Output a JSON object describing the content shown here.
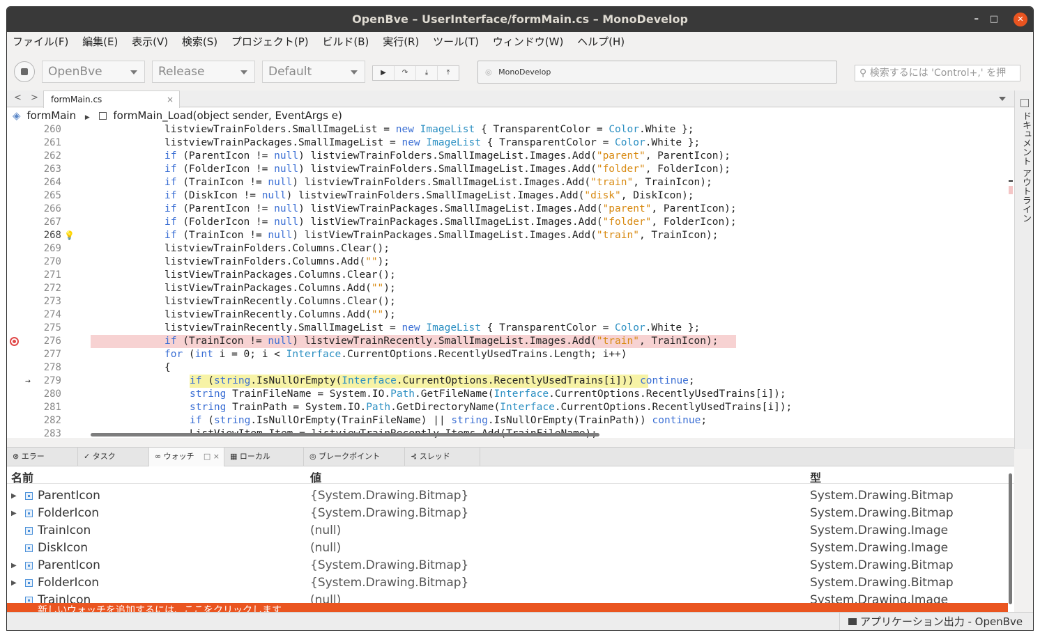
{
  "window": {
    "title": "OpenBve – UserInterface/formMain.cs – MonoDevelop",
    "controls": [
      "–",
      "□",
      "✕"
    ]
  },
  "menu": [
    "ファイル(F)",
    "編集(E)",
    "表示(V)",
    "検索(S)",
    "プロジェクト(P)",
    "ビルド(B)",
    "実行(R)",
    "ツール(T)",
    "ウィンドウ(W)",
    "ヘルプ(H)"
  ],
  "toolbar": {
    "project_combo": "OpenBve",
    "config_combo": "Release",
    "target_combo": "Default",
    "run_icons": [
      "play-icon",
      "step-over-icon",
      "step-into-icon",
      "step-out-icon"
    ],
    "status_text": "MonoDevelop",
    "search_placeholder": "検索するには 'Control+,' を押"
  },
  "tabs": {
    "active": "formMain.cs",
    "close": "×"
  },
  "sidebar": {
    "label": "ドキュメント アウトライン"
  },
  "breadcrumb": {
    "class_name": "formMain",
    "method_name": "formMain_Load(object sender, EventArgs e)"
  },
  "editor": {
    "lines": [
      {
        "num": "260",
        "indent": 1,
        "code": "listviewTrainFolders.SmallImageList = new ImageList { TransparentColor = Color.White };"
      },
      {
        "num": "261",
        "indent": 1,
        "code": "listviewTrainPackages.SmallImageList = new ImageList { TransparentColor = Color.White };"
      },
      {
        "num": "262",
        "indent": 1,
        "code": "if (ParentIcon != null) listviewTrainFolders.SmallImageList.Images.Add(\"parent\", ParentIcon);"
      },
      {
        "num": "263",
        "indent": 1,
        "code": "if (FolderIcon != null) listviewTrainFolders.SmallImageList.Images.Add(\"folder\", FolderIcon);"
      },
      {
        "num": "264",
        "indent": 1,
        "code": "if (TrainIcon != null) listviewTrainFolders.SmallImageList.Images.Add(\"train\", TrainIcon);"
      },
      {
        "num": "265",
        "indent": 1,
        "code": "if (DiskIcon != null) listviewTrainFolders.SmallImageList.Images.Add(\"disk\", DiskIcon);"
      },
      {
        "num": "266",
        "indent": 1,
        "code": "if (ParentIcon != null) listViewTrainPackages.SmallImageList.Images.Add(\"parent\", ParentIcon);"
      },
      {
        "num": "267",
        "indent": 1,
        "code": "if (FolderIcon != null) listViewTrainPackages.SmallImageList.Images.Add(\"folder\", FolderIcon);"
      },
      {
        "num": "268",
        "indent": 1,
        "code": "if (TrainIcon != null) listViewTrainPackages.SmallImageList.Images.Add(\"train\", TrainIcon);",
        "bulb": true
      },
      {
        "num": "269",
        "indent": 1,
        "code": "listviewTrainFolders.Columns.Clear();"
      },
      {
        "num": "270",
        "indent": 1,
        "code": "listviewTrainFolders.Columns.Add(\"\");"
      },
      {
        "num": "271",
        "indent": 1,
        "code": "listViewTrainPackages.Columns.Clear();"
      },
      {
        "num": "272",
        "indent": 1,
        "code": "listViewTrainPackages.Columns.Add(\"\");"
      },
      {
        "num": "273",
        "indent": 1,
        "code": "listviewTrainRecently.Columns.Clear();"
      },
      {
        "num": "274",
        "indent": 1,
        "code": "listviewTrainRecently.Columns.Add(\"\");"
      },
      {
        "num": "275",
        "indent": 1,
        "code": "listviewTrainRecently.SmallImageList = new ImageList { TransparentColor = Color.White };"
      },
      {
        "num": "276",
        "indent": 1,
        "code": "if (TrainIcon != null) listviewTrainRecently.SmallImageList.Images.Add(\"train\", TrainIcon);",
        "breakpoint": true
      },
      {
        "num": "277",
        "indent": 1,
        "code": "for (int i = 0; i < Interface.CurrentOptions.RecentlyUsedTrains.Length; i++)"
      },
      {
        "num": "278",
        "indent": 1,
        "code": "{"
      },
      {
        "num": "279",
        "indent": 2,
        "code": "if (string.IsNullOrEmpty(Interface.CurrentOptions.RecentlyUsedTrains[i])) continue;",
        "current": true
      },
      {
        "num": "280",
        "indent": 2,
        "code": "string TrainFileName = System.IO.Path.GetFileName(Interface.CurrentOptions.RecentlyUsedTrains[i]);"
      },
      {
        "num": "281",
        "indent": 2,
        "code": "string TrainPath = System.IO.Path.GetDirectoryName(Interface.CurrentOptions.RecentlyUsedTrains[i]);"
      },
      {
        "num": "282",
        "indent": 2,
        "code": "if (string.IsNullOrEmpty(TrainFileName) || string.IsNullOrEmpty(TrainPath)) continue;"
      },
      {
        "num": "283",
        "indent": 2,
        "code": "ListViewItem Item = listviewTrainRecently.Items.Add(TrainFileName);"
      }
    ]
  },
  "pads": {
    "tabs": [
      "エラー",
      "タスク",
      "ウォッチ",
      "ローカル",
      "ブレークポイント",
      "スレッド"
    ],
    "active": "ウォッチ"
  },
  "watch": {
    "headers": {
      "name": "名前",
      "value": "値",
      "type": "型"
    },
    "rows": [
      {
        "name": "ParentIcon",
        "value": "{System.Drawing.Bitmap}",
        "type": "System.Drawing.Bitmap",
        "expandable": true
      },
      {
        "name": "FolderIcon",
        "value": "{System.Drawing.Bitmap}",
        "type": "System.Drawing.Bitmap",
        "expandable": true
      },
      {
        "name": "TrainIcon",
        "value": "(null)",
        "type": "System.Drawing.Image",
        "expandable": false
      },
      {
        "name": "DiskIcon",
        "value": "(null)",
        "type": "System.Drawing.Image",
        "expandable": false
      },
      {
        "name": "ParentIcon",
        "value": "{System.Drawing.Bitmap}",
        "type": "System.Drawing.Bitmap",
        "expandable": true
      },
      {
        "name": "FolderIcon",
        "value": "{System.Drawing.Bitmap}",
        "type": "System.Drawing.Bitmap",
        "expandable": true
      },
      {
        "name": "TrainIcon",
        "value": "(null)",
        "type": "System.Drawing.Image",
        "expandable": false
      }
    ],
    "add_hint": "新しいウォッチを追加するには、ここをクリックします"
  },
  "statusbar": {
    "app_output": "アプリケーション出力 - OpenBve"
  },
  "colors": {
    "keyword": "#3b6fd4",
    "string": "#d88a12",
    "type": "#2b8fc2",
    "accent": "#ea5520",
    "breakpoint_bg": "#f7d2d2",
    "current_line_bg": "#f7f3a6"
  }
}
